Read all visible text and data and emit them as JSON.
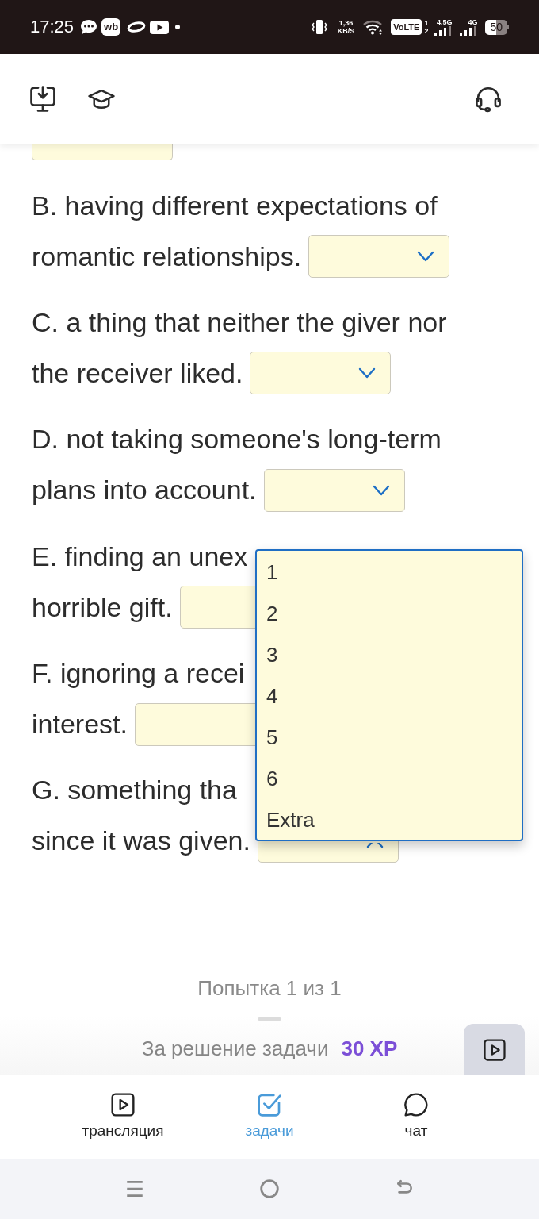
{
  "status_bar": {
    "time": "17:25",
    "app_badge": "wb",
    "speed_value": "1,36",
    "speed_unit": "KB/S",
    "volte": "VoLTE",
    "sim_slots": [
      "1",
      "2"
    ],
    "networks": [
      "4.5G",
      "4G"
    ],
    "battery": "50"
  },
  "questions": [
    {
      "lines": [
        "B. having different expectations of",
        "romantic relationships."
      ],
      "select_open": false
    },
    {
      "lines": [
        "C. a thing that neither the giver nor",
        "the receiver liked."
      ],
      "select_open": false
    },
    {
      "lines": [
        "D. not taking someone's long-term",
        "plans into account."
      ],
      "select_open": false
    },
    {
      "lines": [
        "E. finding an unex",
        "horrible gift."
      ]
    },
    {
      "lines": [
        "F. ignoring a recei",
        "interest."
      ]
    },
    {
      "lines": [
        "G. something tha",
        "since it was given."
      ],
      "select_open": true
    }
  ],
  "dropdown": {
    "options": [
      {
        "label": "1",
        "selected": false
      },
      {
        "label": "2",
        "selected": false
      },
      {
        "label": "3",
        "selected": false
      },
      {
        "label": "4",
        "selected": false
      },
      {
        "label": "5",
        "selected": false
      },
      {
        "label": "6",
        "selected": false
      },
      {
        "label": "Extra",
        "selected": false
      }
    ]
  },
  "attempt": "Попытка 1 из 1",
  "reward": {
    "label": "За решение задачи",
    "points": "30 XP"
  },
  "bottom_nav": [
    {
      "label": "трансляция",
      "selected": false
    },
    {
      "label": "задачи",
      "selected": true
    },
    {
      "label": "чат",
      "selected": false
    }
  ]
}
